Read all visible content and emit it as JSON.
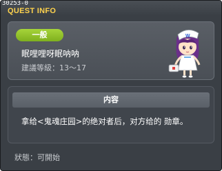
{
  "window": {
    "quest_id": "30253-0",
    "title": "QUEST INFO"
  },
  "summary": {
    "badge_label": "一般",
    "quest_name": "眠哩哩呀眠呐呐",
    "level_range": "建議等級：13～17"
  },
  "details": {
    "header": "内容",
    "description": "拿给<鬼魂庄园>的绝对者后，对方给的 勋章。"
  },
  "footer": {
    "status": "狀態：可開始"
  },
  "colors": {
    "title": "#ffd34d",
    "badge": "#8ec22a",
    "panel": "#4f545b",
    "window": "#3a3f45"
  },
  "icons": {
    "npc": "nurse-npc-portrait"
  }
}
